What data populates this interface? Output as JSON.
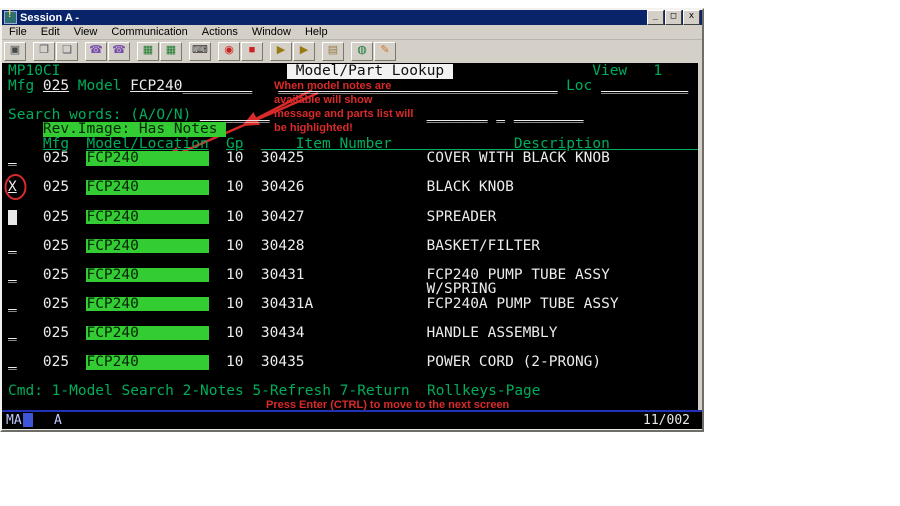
{
  "window": {
    "title": "Session A -",
    "controls": {
      "minimize": "_",
      "maximize": "□",
      "close": "x"
    }
  },
  "menu": {
    "items": [
      "File",
      "Edit",
      "View",
      "Communication",
      "Actions",
      "Window",
      "Help"
    ]
  },
  "toolbar": {
    "buttons": [
      {
        "name": "capture-button",
        "glyph": "▣",
        "color": "#444a4a"
      },
      {
        "name": "copy-button",
        "glyph": "❐",
        "color": "#556",
        "gap": true
      },
      {
        "name": "paste-button",
        "glyph": "❏",
        "color": "#556"
      },
      {
        "name": "connect-button",
        "glyph": "☎",
        "color": "#7a4fae",
        "gap": true
      },
      {
        "name": "disconnect-button",
        "glyph": "☎",
        "color": "#7a4fae"
      },
      {
        "name": "display-session-button",
        "glyph": "▦",
        "color": "#1a7a2a",
        "gap": true
      },
      {
        "name": "color-mapping-button",
        "glyph": "▦",
        "color": "#1a7a2a"
      },
      {
        "name": "keyboard-setup-button",
        "glyph": "⌨",
        "color": "#333",
        "gap": true
      },
      {
        "name": "record-macro-button",
        "glyph": "◉",
        "color": "#cc2222",
        "gap": true
      },
      {
        "name": "stop-macro-button",
        "glyph": "■",
        "color": "#cc2222"
      },
      {
        "name": "play-macro-button",
        "glyph": "▶",
        "color": "#9a7a10",
        "gap": true
      },
      {
        "name": "step-macro-button",
        "glyph": "▶",
        "color": "#9a7a10"
      },
      {
        "name": "notepad-button",
        "glyph": "▤",
        "color": "#9a7a44",
        "gap": true
      },
      {
        "name": "web-button",
        "glyph": "◍",
        "color": "#1a7a3a",
        "gap": true
      },
      {
        "name": "edit-link-button",
        "glyph": "✎",
        "color": "#cc7733"
      }
    ]
  },
  "terminal": {
    "segments": [
      {
        "r": 0,
        "c": 0,
        "t": "MP10CI",
        "s": "g",
        "n": "program-id",
        "i": false
      },
      {
        "r": 0,
        "c": 32,
        "t": " Model/Part Lookup ",
        "s": "rev",
        "n": "screen-title",
        "i": false
      },
      {
        "r": 0,
        "c": 67,
        "t": "View   1",
        "s": "g",
        "n": "view-number",
        "i": false
      },
      {
        "r": 1,
        "c": 0,
        "t": "Mfg",
        "s": "g",
        "n": "mfg-label",
        "i": false
      },
      {
        "r": 1,
        "c": 4,
        "t": "025",
        "s": "wu",
        "n": "mfg-field",
        "i": true
      },
      {
        "r": 1,
        "c": 8,
        "t": "Model",
        "s": "g",
        "n": "model-label",
        "i": false
      },
      {
        "r": 1,
        "c": 14,
        "t": "FCP240________",
        "s": "wu",
        "n": "model-field",
        "i": true
      },
      {
        "r": 1,
        "c": 31,
        "t": "________________________________",
        "s": "wu",
        "n": "model-desc-field",
        "i": true
      },
      {
        "r": 1,
        "c": 64,
        "t": "Loc",
        "s": "g",
        "n": "loc-label",
        "i": false
      },
      {
        "r": 1,
        "c": 68,
        "t": "__________",
        "s": "wu",
        "n": "loc-field",
        "i": true
      },
      {
        "r": 3,
        "c": 0,
        "t": "Search words: (A/O/N)",
        "s": "g",
        "n": "search-words-label",
        "i": false
      },
      {
        "r": 3,
        "c": 22,
        "t": "________",
        "s": "wu",
        "n": "search-word-field-1",
        "i": true
      },
      {
        "r": 3,
        "c": 48,
        "t": "_______",
        "s": "wu",
        "n": "search-word-field-2",
        "i": true
      },
      {
        "r": 3,
        "c": 56,
        "t": "_",
        "s": "wu",
        "n": "search-word-field-3",
        "i": true
      },
      {
        "r": 3,
        "c": 58,
        "t": "________",
        "s": "wu",
        "n": "search-word-field-4",
        "i": true
      },
      {
        "r": 4,
        "c": 4,
        "t": "Rev.Image: Has Notes ",
        "s": "hi",
        "n": "rev-image-has-notes-banner",
        "i": false
      },
      {
        "r": 5,
        "c": 4,
        "t": "Mfg",
        "s": "gu",
        "n": "col-header-mfg",
        "i": false
      },
      {
        "r": 5,
        "c": 9,
        "t": "Model/Location",
        "s": "gu",
        "n": "col-header-model-location",
        "i": false
      },
      {
        "r": 5,
        "c": 25,
        "t": "Gp",
        "s": "gu",
        "n": "col-header-gp",
        "i": false
      },
      {
        "r": 5,
        "c": 29,
        "t": "    Item Number    ",
        "s": "gu",
        "n": "col-header-item-number",
        "i": false
      },
      {
        "r": 5,
        "c": 48,
        "t": "          Description           ",
        "s": "gu",
        "n": "col-header-description",
        "i": false
      },
      {
        "r": 6,
        "c": 0,
        "t": "_",
        "s": "wu",
        "n": "select-field",
        "i": true
      },
      {
        "r": 6,
        "c": 4,
        "t": "025",
        "s": "w",
        "n": "cell-mfg",
        "i": false
      },
      {
        "r": 6,
        "c": 9,
        "t": "FCP240        ",
        "s": "hi",
        "n": "cell-model-highlighted",
        "i": false
      },
      {
        "r": 6,
        "c": 25,
        "t": "10",
        "s": "w",
        "n": "cell-gp",
        "i": false
      },
      {
        "r": 6,
        "c": 29,
        "t": "30425",
        "s": "w",
        "n": "cell-item-number",
        "i": false
      },
      {
        "r": 6,
        "c": 48,
        "t": "COVER WITH BLACK KNOB",
        "s": "w",
        "n": "cell-description",
        "i": false
      },
      {
        "r": 8,
        "c": 0,
        "t": "X",
        "s": "wu",
        "n": "select-field-x",
        "i": true
      },
      {
        "r": 8,
        "c": 4,
        "t": "025",
        "s": "w",
        "n": "cell-mfg",
        "i": false
      },
      {
        "r": 8,
        "c": 9,
        "t": "FCP240        ",
        "s": "hi",
        "n": "cell-model-highlighted",
        "i": false
      },
      {
        "r": 8,
        "c": 25,
        "t": "10",
        "s": "w",
        "n": "cell-gp",
        "i": false
      },
      {
        "r": 8,
        "c": 29,
        "t": "30426",
        "s": "w",
        "n": "cell-item-number",
        "i": false
      },
      {
        "r": 8,
        "c": 48,
        "t": "BLACK KNOB",
        "s": "w",
        "n": "cell-description",
        "i": false
      },
      {
        "r": 10,
        "c": 0,
        "t": " ",
        "s": "cur",
        "n": "text-cursor-block",
        "i": true
      },
      {
        "r": 10,
        "c": 4,
        "t": "025",
        "s": "w",
        "n": "cell-mfg",
        "i": false
      },
      {
        "r": 10,
        "c": 9,
        "t": "FCP240        ",
        "s": "hi",
        "n": "cell-model-highlighted",
        "i": false
      },
      {
        "r": 10,
        "c": 25,
        "t": "10",
        "s": "w",
        "n": "cell-gp",
        "i": false
      },
      {
        "r": 10,
        "c": 29,
        "t": "30427",
        "s": "w",
        "n": "cell-item-number",
        "i": false
      },
      {
        "r": 10,
        "c": 48,
        "t": "SPREADER",
        "s": "w",
        "n": "cell-description",
        "i": false
      },
      {
        "r": 12,
        "c": 0,
        "t": "_",
        "s": "wu",
        "n": "select-field",
        "i": true
      },
      {
        "r": 12,
        "c": 4,
        "t": "025",
        "s": "w",
        "n": "cell-mfg",
        "i": false
      },
      {
        "r": 12,
        "c": 9,
        "t": "FCP240        ",
        "s": "hi",
        "n": "cell-model-highlighted",
        "i": false
      },
      {
        "r": 12,
        "c": 25,
        "t": "10",
        "s": "w",
        "n": "cell-gp",
        "i": false
      },
      {
        "r": 12,
        "c": 29,
        "t": "30428",
        "s": "w",
        "n": "cell-item-number",
        "i": false
      },
      {
        "r": 12,
        "c": 48,
        "t": "BASKET/FILTER",
        "s": "w",
        "n": "cell-description",
        "i": false
      },
      {
        "r": 14,
        "c": 0,
        "t": "_",
        "s": "wu",
        "n": "select-field",
        "i": true
      },
      {
        "r": 14,
        "c": 4,
        "t": "025",
        "s": "w",
        "n": "cell-mfg",
        "i": false
      },
      {
        "r": 14,
        "c": 9,
        "t": "FCP240        ",
        "s": "hi",
        "n": "cell-model-highlighted",
        "i": false
      },
      {
        "r": 14,
        "c": 25,
        "t": "10",
        "s": "w",
        "n": "cell-gp",
        "i": false
      },
      {
        "r": 14,
        "c": 29,
        "t": "30431",
        "s": "w",
        "n": "cell-item-number",
        "i": false
      },
      {
        "r": 14,
        "c": 48,
        "t": "FCP240 PUMP TUBE ASSY",
        "s": "w",
        "n": "cell-description",
        "i": false
      },
      {
        "r": 15,
        "c": 48,
        "t": "W/SPRING",
        "s": "w",
        "n": "cell-description-cont",
        "i": false
      },
      {
        "r": 16,
        "c": 0,
        "t": "_",
        "s": "wu",
        "n": "select-field",
        "i": true
      },
      {
        "r": 16,
        "c": 4,
        "t": "025",
        "s": "w",
        "n": "cell-mfg",
        "i": false
      },
      {
        "r": 16,
        "c": 9,
        "t": "FCP240        ",
        "s": "hi",
        "n": "cell-model-highlighted",
        "i": false
      },
      {
        "r": 16,
        "c": 25,
        "t": "10",
        "s": "w",
        "n": "cell-gp",
        "i": false
      },
      {
        "r": 16,
        "c": 29,
        "t": "30431A",
        "s": "w",
        "n": "cell-item-number",
        "i": false
      },
      {
        "r": 16,
        "c": 48,
        "t": "FCP240A PUMP TUBE ASSY",
        "s": "w",
        "n": "cell-description",
        "i": false
      },
      {
        "r": 18,
        "c": 0,
        "t": "_",
        "s": "wu",
        "n": "select-field",
        "i": true
      },
      {
        "r": 18,
        "c": 4,
        "t": "025",
        "s": "w",
        "n": "cell-mfg",
        "i": false
      },
      {
        "r": 18,
        "c": 9,
        "t": "FCP240        ",
        "s": "hi",
        "n": "cell-model-highlighted",
        "i": false
      },
      {
        "r": 18,
        "c": 25,
        "t": "10",
        "s": "w",
        "n": "cell-gp",
        "i": false
      },
      {
        "r": 18,
        "c": 29,
        "t": "30434",
        "s": "w",
        "n": "cell-item-number",
        "i": false
      },
      {
        "r": 18,
        "c": 48,
        "t": "HANDLE ASSEMBLY",
        "s": "w",
        "n": "cell-description",
        "i": false
      },
      {
        "r": 20,
        "c": 0,
        "t": "_",
        "s": "wu",
        "n": "select-field",
        "i": true
      },
      {
        "r": 20,
        "c": 4,
        "t": "025",
        "s": "w",
        "n": "cell-mfg",
        "i": false
      },
      {
        "r": 20,
        "c": 9,
        "t": "FCP240        ",
        "s": "hi",
        "n": "cell-model-highlighted",
        "i": false
      },
      {
        "r": 20,
        "c": 25,
        "t": "10",
        "s": "w",
        "n": "cell-gp",
        "i": false
      },
      {
        "r": 20,
        "c": 29,
        "t": "30435",
        "s": "w",
        "n": "cell-item-number",
        "i": false
      },
      {
        "r": 20,
        "c": 48,
        "t": "POWER CORD (2-PRONG)",
        "s": "w",
        "n": "cell-description",
        "i": false
      },
      {
        "r": 22,
        "c": 0,
        "t": "Cmd: 1-Model Search 2-Notes 5-Refresh 7-Return  Rollkeys-Page",
        "s": "g",
        "n": "command-line",
        "i": false
      },
      {
        "r": 23,
        "c": 62,
        "t": "_",
        "s": "w",
        "n": "trailing-cursor-underscore",
        "i": false
      }
    ]
  },
  "annotations": {
    "note_lines": [
      "When model notes are",
      "available will show",
      "message and parts list will",
      "be highlighted!"
    ],
    "press_enter": "Press Enter (CTRL) to move to the next screen",
    "annotation_color": "#d92a2a"
  },
  "oia": {
    "state": "MA",
    "session": "A",
    "cursor_position": "11/002"
  },
  "colors": {
    "terminal_green": "#00ad5b",
    "highlight_green": "#33cc33",
    "terminal_white": "#ececec",
    "titlebar_blue": "#0a246a",
    "oia_blue": "#2331b8"
  }
}
